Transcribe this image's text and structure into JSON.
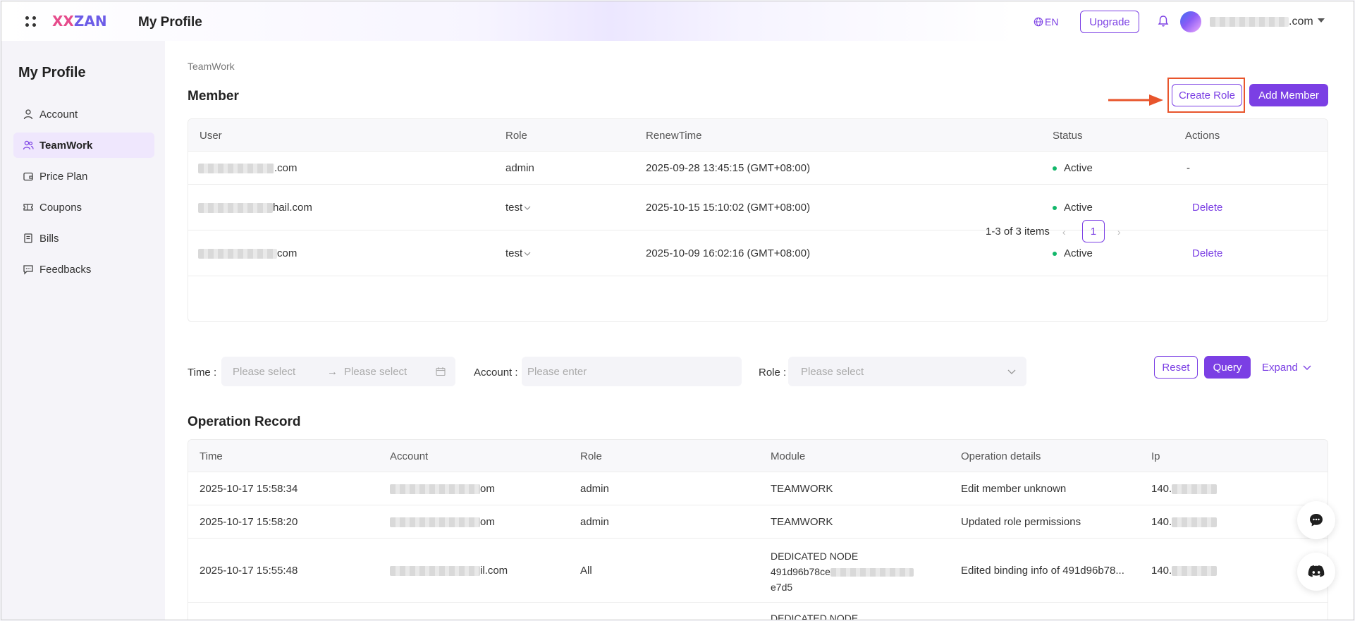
{
  "topbar": {
    "logo_part1": "XX",
    "logo_part2": "ZAN",
    "title": "My Profile",
    "lang": "EN",
    "upgrade_label": "Upgrade",
    "email_suffix": ".com"
  },
  "sidebar": {
    "title": "My Profile",
    "items": [
      {
        "label": "Account",
        "icon": "user-icon"
      },
      {
        "label": "TeamWork",
        "icon": "team-icon",
        "active": true
      },
      {
        "label": "Price Plan",
        "icon": "wallet-icon"
      },
      {
        "label": "Coupons",
        "icon": "ticket-icon"
      },
      {
        "label": "Bills",
        "icon": "document-icon"
      },
      {
        "label": "Feedbacks",
        "icon": "message-icon"
      }
    ]
  },
  "main": {
    "breadcrumb": "TeamWork",
    "member_title": "Member",
    "create_role_label": "Create Role",
    "add_member_label": "Add Member",
    "member_table": {
      "headers": [
        "User",
        "Role",
        "RenewTime",
        "Status",
        "Actions"
      ],
      "rows": [
        {
          "user_suffix": ".com",
          "role": "admin",
          "role_dropdown": false,
          "renew": "2025-09-28 13:45:15 (GMT+08:00)",
          "status": "Active",
          "action": "-"
        },
        {
          "user_suffix": "hail.com",
          "role": "test",
          "role_dropdown": true,
          "renew": "2025-10-15 15:10:02 (GMT+08:00)",
          "status": "Active",
          "action": "Delete"
        },
        {
          "user_suffix": "com",
          "role": "test",
          "role_dropdown": true,
          "renew": "2025-10-09 16:02:16 (GMT+08:00)",
          "status": "Active",
          "action": "Delete"
        }
      ],
      "pagination_summary": "1-3 of 3 items",
      "current_page": "1"
    },
    "filters": {
      "time_label": "Time :",
      "time_start_placeholder": "Please select",
      "time_end_placeholder": "Please select",
      "account_label": "Account :",
      "account_placeholder": "Please enter",
      "role_label": "Role :",
      "role_placeholder": "Please select",
      "reset_label": "Reset",
      "query_label": "Query",
      "expand_label": "Expand"
    },
    "op_title": "Operation Record",
    "op_table": {
      "headers": [
        "Time",
        "Account",
        "Role",
        "Module",
        "Operation details",
        "Ip"
      ],
      "rows": [
        {
          "time": "2025-10-17 15:58:34",
          "account_suffix": "om",
          "role": "admin",
          "module_line1": "TEAMWORK",
          "module_line2": "",
          "module_line3": "",
          "details": "Edit member unknown",
          "ip_prefix": "140."
        },
        {
          "time": "2025-10-17 15:58:20",
          "account_suffix": "om",
          "role": "admin",
          "module_line1": "TEAMWORK",
          "module_line2": "",
          "module_line3": "",
          "details": "Updated role permissions",
          "ip_prefix": "140."
        },
        {
          "time": "2025-10-17 15:55:48",
          "account_suffix": "il.com",
          "role": "All",
          "module_line1": "DEDICATED NODE",
          "module_line2": "491d96b78ce",
          "module_line3": "e7d5",
          "details": "Edited binding info of 491d96b78...",
          "ip_prefix": "140."
        },
        {
          "time": "",
          "account_suffix": "",
          "role": "",
          "module_line1": "DEDICATED NODE",
          "module_line2": "",
          "module_line3": "",
          "details": "",
          "ip_prefix": ""
        }
      ]
    }
  },
  "floating": {
    "chat_icon": "chat-bubble-icon",
    "discord_icon": "discord-icon"
  },
  "colors": {
    "accent": "#7b3fe4",
    "highlight": "#e8552c",
    "active_bg": "#efe7fd",
    "status_green": "#12b76a"
  }
}
